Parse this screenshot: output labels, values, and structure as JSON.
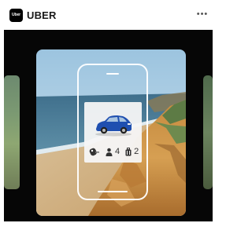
{
  "app": {
    "logo_text": "Uber",
    "title": "UBER",
    "more_glyph": "•••"
  },
  "card": {
    "scene": "coastal-beach-cliffs",
    "vehicle_icon": "car-icon",
    "seats_icon": "person-icon",
    "seats_count": "4",
    "bags_icon": "luggage-icon",
    "bags_count": "2",
    "key_icon": "car-key-icon"
  },
  "colors": {
    "brand": "#000000",
    "stage_bg": "#060606",
    "car_blue": "#1f4fb0",
    "phone_outline": "#ffffff"
  }
}
